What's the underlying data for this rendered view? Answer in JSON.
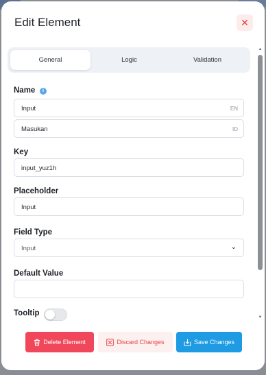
{
  "colors": {
    "danger": "#f0485a",
    "primary": "#1e9be3",
    "info": "#5aa7ea"
  },
  "modal": {
    "title": "Edit Element",
    "close_icon": "close-icon"
  },
  "tabs": [
    {
      "label": "General",
      "active": true
    },
    {
      "label": "Logic",
      "active": false
    },
    {
      "label": "Validation",
      "active": false
    }
  ],
  "form": {
    "name": {
      "label": "Name",
      "info_icon": "info-icon",
      "en_value": "Input",
      "en_tag": "EN",
      "id_value": "Masukan",
      "id_tag": "ID"
    },
    "key": {
      "label": "Key",
      "value": "input_yuz1h"
    },
    "placeholder": {
      "label": "Placeholder",
      "value": "Input"
    },
    "field_type": {
      "label": "Field Type",
      "value": "Input",
      "icon": "chevron-down-icon"
    },
    "default_value": {
      "label": "Default Value",
      "value": ""
    },
    "tooltip": {
      "label": "Tooltip",
      "enabled": false
    }
  },
  "footer": {
    "delete_label": "Delete Element",
    "delete_icon": "trash-icon",
    "discard_label": "Discard Changes",
    "discard_icon": "discard-icon",
    "save_label": "Save Changes",
    "save_icon": "save-icon"
  }
}
